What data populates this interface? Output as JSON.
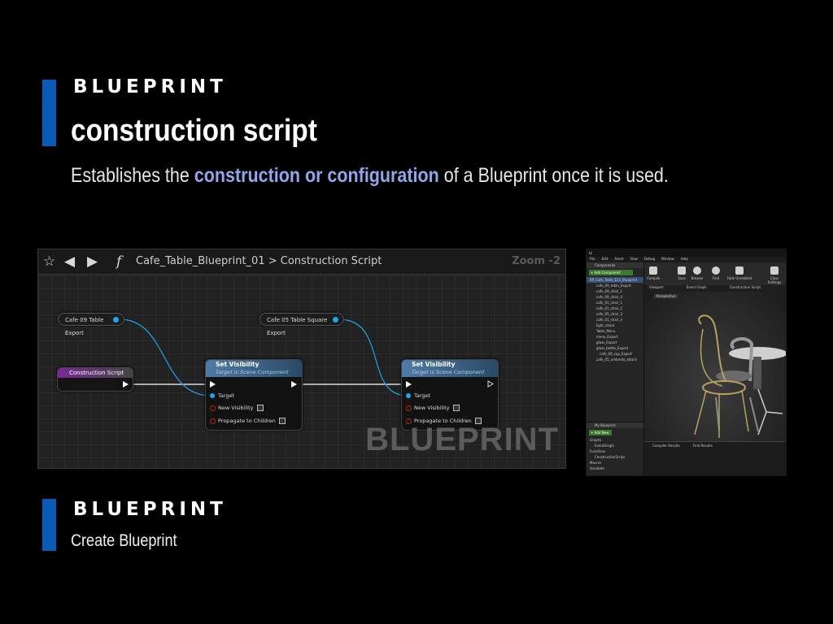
{
  "header": {
    "section_label": "BLUEPRINT",
    "title": "construction script",
    "description_pre": "Establishes the ",
    "description_highlight": "construction or configuration",
    "description_post": " of a Blueprint once it is used."
  },
  "graph_editor": {
    "breadcrumb_asset": "Cafe_Table_Blueprint_01",
    "breadcrumb_separator": ">",
    "breadcrumb_graph": "Construction Script",
    "zoom": "Zoom -2",
    "watermark": "BLUEPRINT",
    "nodes": {
      "var1": "Cafe 09 Table Export",
      "var2": "Cafe 05 Table Square Export",
      "construction": "Construction Script",
      "set_visibility_title": "Set Visibility",
      "set_visibility_sub": "Target is Scene Component",
      "pin_target": "Target",
      "pin_new_visibility": "New Visibility",
      "pin_propagate": "Propagate to Children"
    }
  },
  "editor_preview": {
    "menu": [
      "File",
      "Edit",
      "Asset",
      "View",
      "Debug",
      "Window",
      "Help"
    ],
    "components_label": "Components",
    "add_component": "+ Add Component",
    "tree": [
      "BP_Cafe_Table_Ex2_Blueprint",
      "cafe_09_table_Export",
      "cafe_09_chair_1",
      "cafe_09_chair_4",
      "cafe_01_chair_1",
      "cafe_01_chair_2",
      "cafe_05_chair_3",
      "cafe_01_chair_3",
      "light_stand",
      "Table_Menu",
      "menu_Export",
      "glass_Export",
      "glass_bottle_Export",
      "cafe_09_cup_Export",
      "cafe_05_umbrella_attach"
    ],
    "toolbar": [
      "Compile",
      "Save",
      "Browse",
      "Find",
      "Hide Unrelated",
      "Class Settings"
    ],
    "tabs": [
      "Viewport",
      "Event Graph",
      "Construction Script"
    ],
    "viewport_mode": "Perspective",
    "my_blueprint": "My Blueprint",
    "add_new": "+ Add New",
    "sections": [
      "Graphs",
      "EventGraph",
      "Functions",
      "ConstructionScript",
      "Macros",
      "Variables"
    ],
    "bottom_tabs": [
      "Compiler Results",
      "Find Results"
    ]
  },
  "footer": {
    "section_label": "BLUEPRINT",
    "subtitle": "Create Blueprint"
  }
}
